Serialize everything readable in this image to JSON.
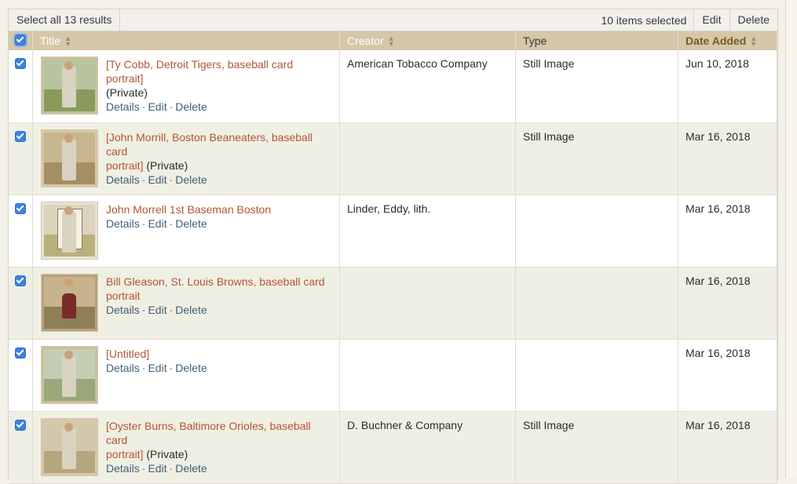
{
  "toolbar": {
    "select_all_label": "Select all 13 results",
    "selected_count": "10 items selected",
    "edit_label": "Edit",
    "delete_label": "Delete"
  },
  "columns": {
    "title": "Title",
    "creator": "Creator",
    "type": "Type",
    "date": "Date Added"
  },
  "actions": {
    "details": "Details",
    "edit": "Edit",
    "delete": "Delete",
    "separator": "·"
  },
  "colors": {
    "header_bg": "#d5c7a8",
    "link": "#b25536",
    "checkbox": "#3b82e0",
    "alt_row": "#f0efe3"
  },
  "rows": [
    {
      "title_line1": "[Ty Cobb, Detroit Tigers, baseball card portrait]",
      "title_line2": "",
      "private": "(Private)",
      "creator": "American Tobacco Company",
      "type": "Still Image",
      "date": "Jun 10, 2018",
      "checked": true
    },
    {
      "title_line1": "[John Morrill, Boston Beaneaters, baseball card",
      "title_line2": "portrait]",
      "private": "(Private)",
      "creator": "",
      "type": "Still Image",
      "date": "Mar 16, 2018",
      "checked": true
    },
    {
      "title_line1": "John Morrell 1st Baseman Boston",
      "title_line2": "",
      "private": "",
      "creator": "Linder, Eddy, lith.",
      "type": "",
      "date": "Mar 16, 2018",
      "checked": true
    },
    {
      "title_line1": "Bill Gleason, St. Louis Browns, baseball card",
      "title_line2": "portrait",
      "private": "",
      "creator": "",
      "type": "",
      "date": "Mar 16, 2018",
      "checked": true
    },
    {
      "title_line1": "[Untitled]",
      "title_line2": "",
      "private": "",
      "creator": "",
      "type": "",
      "date": "Mar 16, 2018",
      "checked": true
    },
    {
      "title_line1": "[Oyster Burns, Baltimore Orioles, baseball card",
      "title_line2": "portrait]",
      "private": "(Private)",
      "creator": "D. Buchner & Company",
      "type": "Still Image",
      "date": "Mar 16, 2018",
      "checked": true
    }
  ]
}
